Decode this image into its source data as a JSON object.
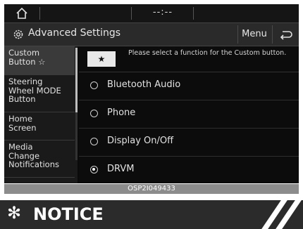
{
  "status_bar": {
    "clock": "--:--"
  },
  "header": {
    "title": "Advanced Settings",
    "menu_label": "Menu"
  },
  "sidebar": {
    "items": [
      {
        "label": "Custom\nButton ☆",
        "selected": true
      },
      {
        "label": "Steering\nWheel MODE\nButton",
        "selected": false
      },
      {
        "label": "Home\nScreen",
        "selected": false
      },
      {
        "label": "Media\nChange\nNotifications",
        "selected": false
      }
    ]
  },
  "content": {
    "star_button": "★",
    "instruction": "Please select a function for the Custom button.",
    "options": [
      {
        "label": "Bluetooth Audio",
        "selected": false
      },
      {
        "label": "Phone",
        "selected": false
      },
      {
        "label": "Display On/Off",
        "selected": false
      },
      {
        "label": "DRVM",
        "selected": true
      }
    ]
  },
  "caption": "OSP2I049433",
  "notice": {
    "symbol": "✻",
    "title": "NOTICE"
  },
  "colors": {
    "screen_bg": "#0a0a0a",
    "notice_bg": "#2b2b2b",
    "caption_bg": "#8c8c8c"
  }
}
